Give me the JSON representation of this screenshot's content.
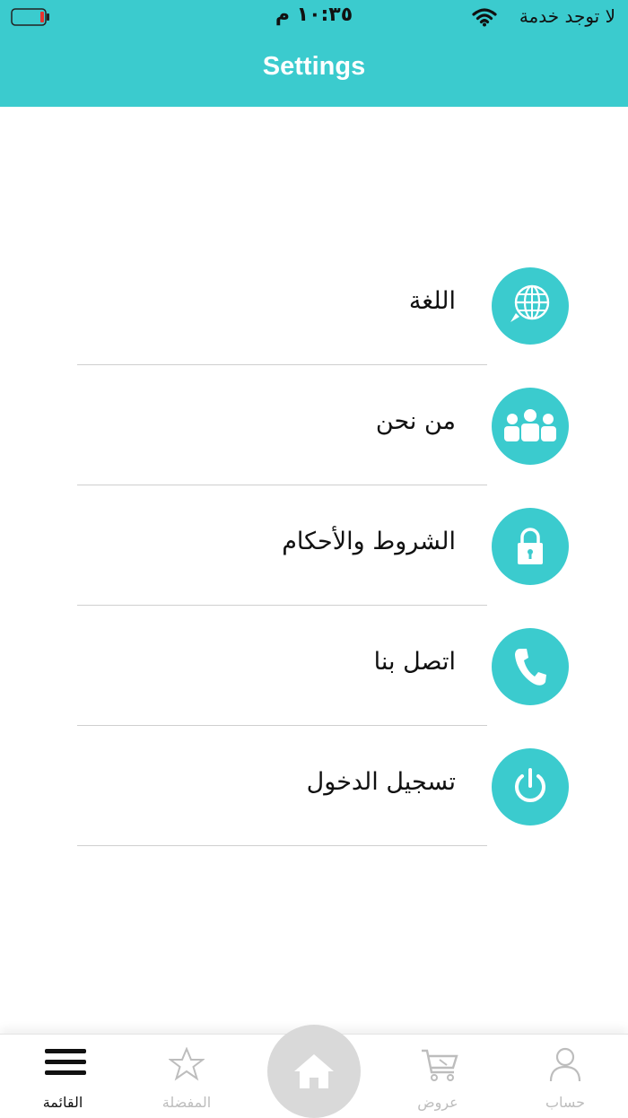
{
  "status_bar": {
    "carrier": "لا توجد خدمة",
    "time": "١٠:٣٥ م",
    "battery_color": "#e8322f"
  },
  "header": {
    "title": "Settings",
    "background": "#3bcbce"
  },
  "menu": {
    "items": [
      {
        "label": "اللغة",
        "icon": "globe-chat-icon"
      },
      {
        "label": "من نحن",
        "icon": "group-icon"
      },
      {
        "label": "الشروط والأحكام",
        "icon": "lock-icon"
      },
      {
        "label": "اتصل بنا",
        "icon": "phone-icon"
      },
      {
        "label": "تسجيل الدخول",
        "icon": "power-icon"
      }
    ]
  },
  "tab_bar": {
    "tabs": [
      {
        "label": "القائمة",
        "icon": "hamburger-menu-icon",
        "active": true
      },
      {
        "label": "المفضلة",
        "icon": "star-icon",
        "active": false
      },
      {
        "label": "",
        "icon": "home-icon",
        "active": false
      },
      {
        "label": "عروض",
        "icon": "cart-icon",
        "active": false
      },
      {
        "label": "حساب",
        "icon": "person-icon",
        "active": false
      }
    ],
    "active_color": "#111111",
    "inactive_color": "#bdbdbd"
  }
}
